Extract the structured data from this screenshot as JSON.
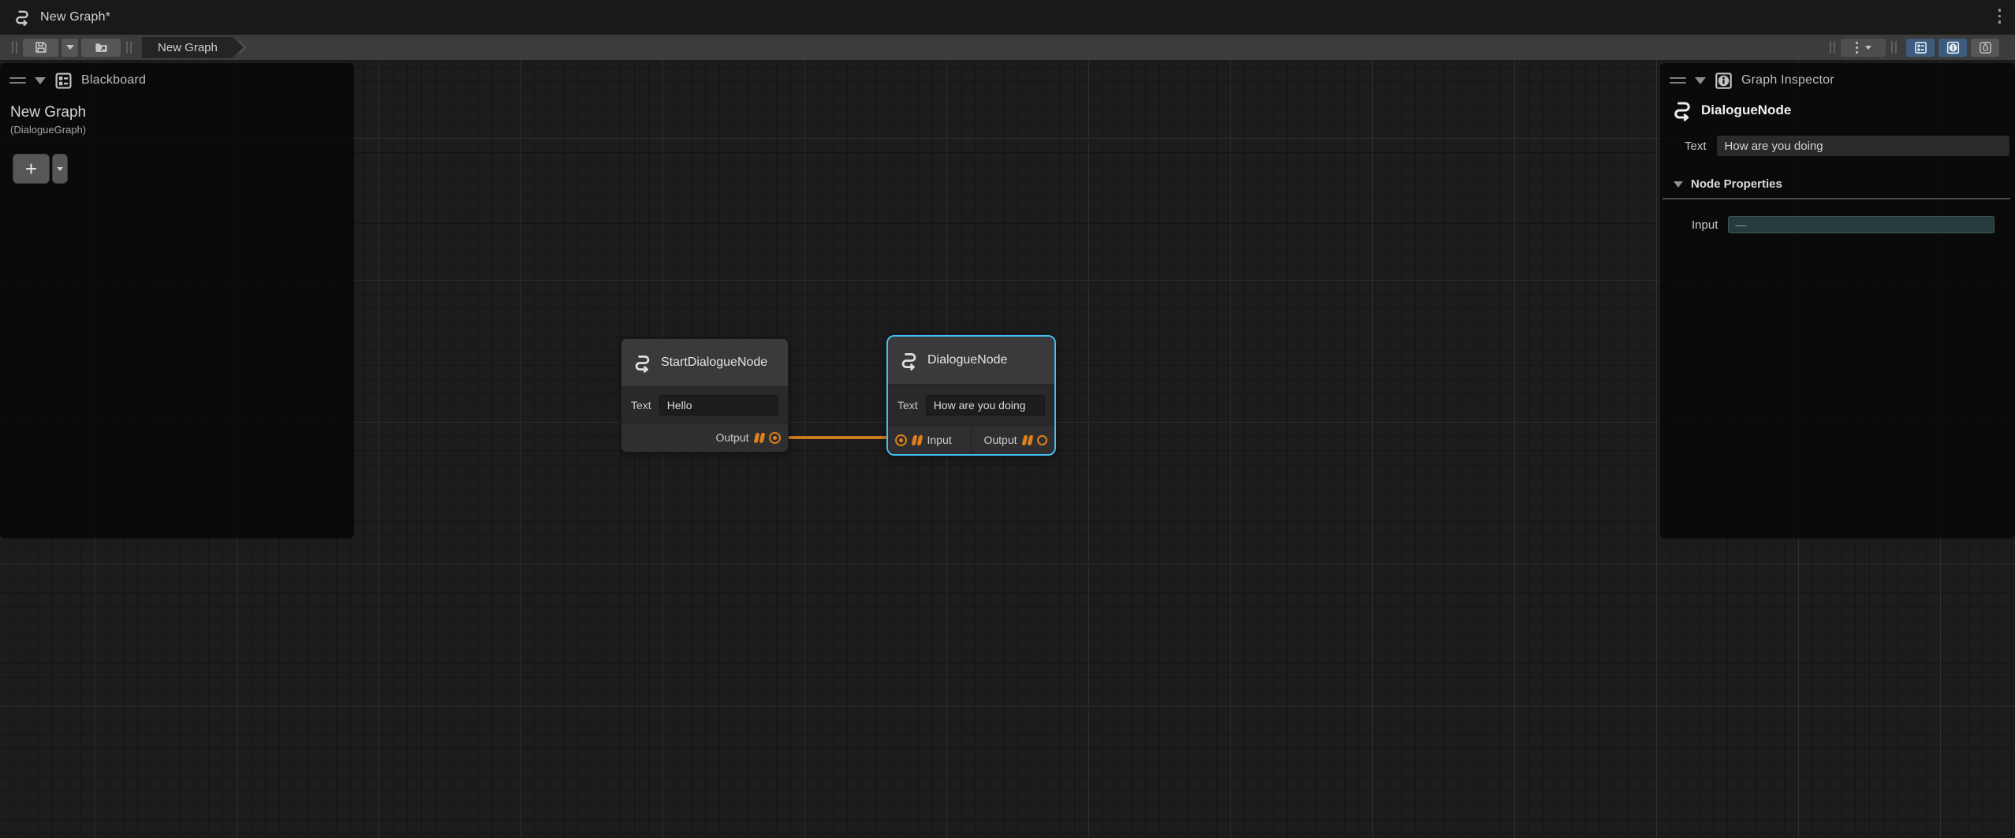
{
  "window": {
    "title": "New Graph*"
  },
  "toolbar": {
    "breadcrumb": "New Graph"
  },
  "blackboard": {
    "header": "Blackboard",
    "graph_name": "New Graph",
    "graph_type": "(DialogueGraph)",
    "add_label": "+"
  },
  "inspector": {
    "header": "Graph Inspector",
    "node_title": "DialogueNode",
    "text_label": "Text",
    "text_value": "How are you doing",
    "node_properties_label": "Node Properties",
    "input_label": "Input",
    "input_value": "—"
  },
  "nodes": {
    "start": {
      "title": "StartDialogueNode",
      "text_label": "Text",
      "text_value": "Hello",
      "output_label": "Output"
    },
    "dialogue": {
      "title": "DialogueNode",
      "text_label": "Text",
      "text_value": "How are you doing",
      "input_label": "Input",
      "output_label": "Output",
      "selected": true
    }
  },
  "colors": {
    "selection_blue": "#44C1F7",
    "port_orange": "#E0801A",
    "edge_orange": "#C97B1D",
    "toggle_active_blue": "#3D5C7D"
  }
}
